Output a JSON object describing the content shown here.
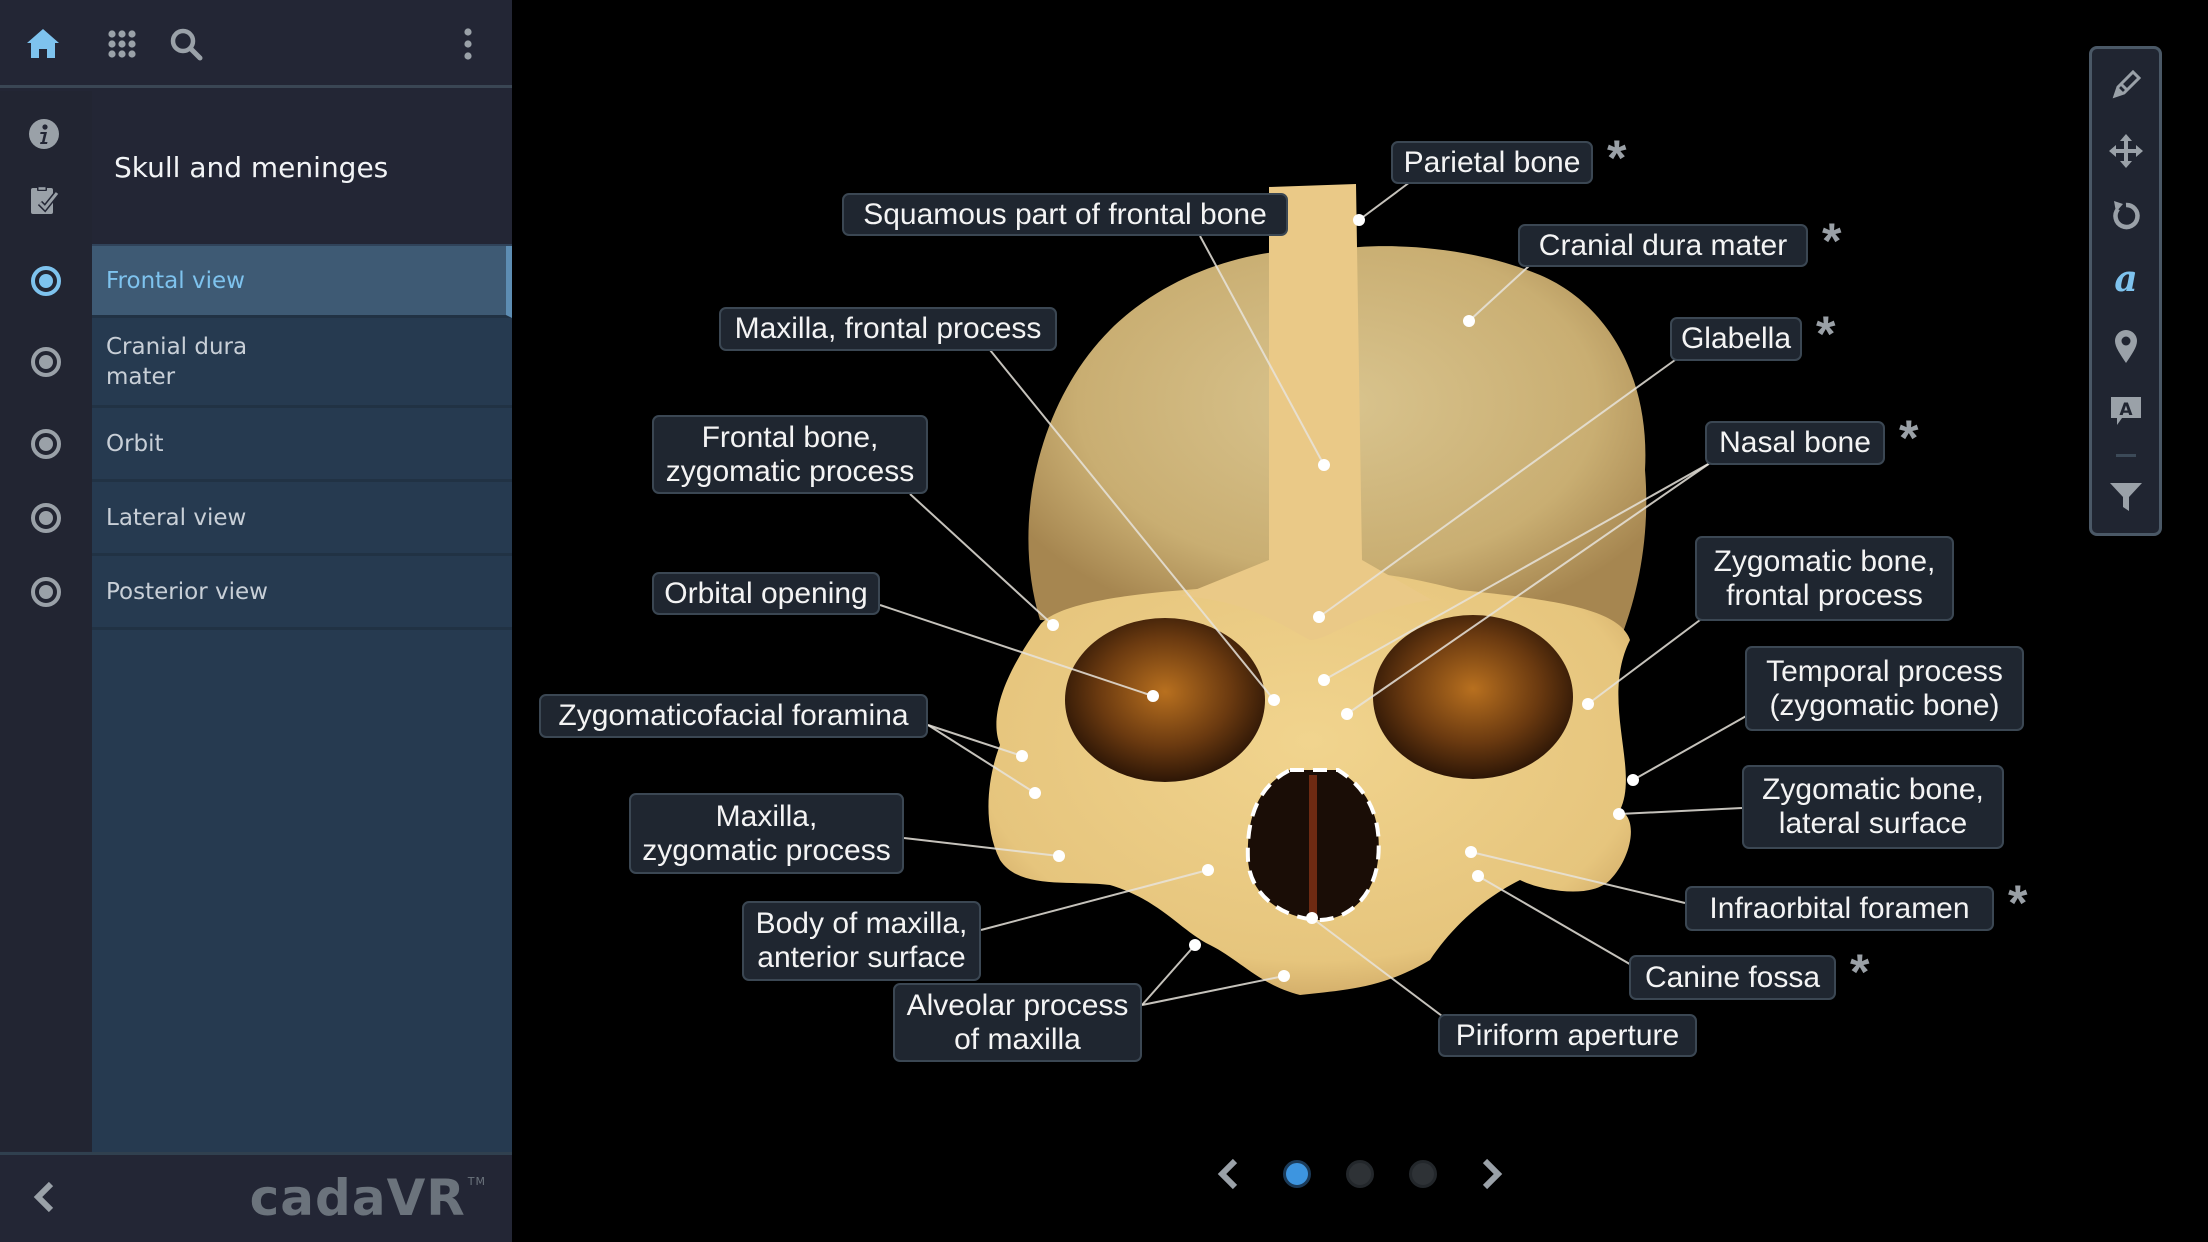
{
  "topbar": {
    "icons": [
      "home-icon",
      "apps-grid-icon",
      "search-icon",
      "more-vertical-icon"
    ]
  },
  "module": {
    "title": "Skull and meninges",
    "rail_icons": [
      "info-icon",
      "quiz-clipboard-icon"
    ]
  },
  "views": [
    {
      "label": "Frontal view",
      "active": true
    },
    {
      "label": "Cranial dura\nmater",
      "active": false
    },
    {
      "label": "Orbit",
      "active": false
    },
    {
      "label": "Lateral view",
      "active": false
    },
    {
      "label": "Posterior view",
      "active": false
    }
  ],
  "brand": {
    "name": "cadaVR",
    "trademark": "TM"
  },
  "toolbar": {
    "tools": [
      {
        "name": "draw",
        "icon": "pencil-icon",
        "active": false
      },
      {
        "name": "move",
        "icon": "move-arrows-icon",
        "active": false
      },
      {
        "name": "reset",
        "icon": "rotate-reset-icon",
        "active": false
      },
      {
        "name": "labels",
        "icon": "label-a-icon",
        "active": true
      },
      {
        "name": "pins",
        "icon": "map-pin-icon",
        "active": false
      },
      {
        "name": "annotations",
        "icon": "text-bubble-icon",
        "active": false
      },
      {
        "name": "filter",
        "icon": "filter-icon",
        "active": false
      }
    ]
  },
  "pager": {
    "pages": 3,
    "current": 1
  },
  "colors": {
    "accent": "#7ec3ee",
    "active_dot": "#3d95e0",
    "inactive_dot": "#2e3236",
    "sidebar_bg": "#232635",
    "list_bg": "#263a50",
    "active_item_bg": "#3e5a74",
    "label_bg": "#1f2630"
  },
  "labels": [
    {
      "text": "Parietal bone",
      "starred": true
    },
    {
      "text": "Squamous part of frontal bone",
      "starred": false
    },
    {
      "text": "Cranial dura mater",
      "starred": true
    },
    {
      "text": "Maxilla, frontal process",
      "starred": false
    },
    {
      "text": "Glabella",
      "starred": true
    },
    {
      "text": "Frontal bone,\nzygomatic process",
      "starred": false
    },
    {
      "text": "Nasal bone",
      "starred": true
    },
    {
      "text": "Zygomatic bone,\nfrontal process",
      "starred": false
    },
    {
      "text": "Orbital opening",
      "starred": false
    },
    {
      "text": "Temporal process\n(zygomatic bone)",
      "starred": false
    },
    {
      "text": "Zygomaticofacial foramina",
      "starred": false
    },
    {
      "text": "Zygomatic bone,\nlateral surface",
      "starred": false
    },
    {
      "text": "Maxilla,\nzygomatic process",
      "starred": false
    },
    {
      "text": "Infraorbital foramen",
      "starred": true
    },
    {
      "text": "Body of maxilla,\nanterior surface",
      "starred": false
    },
    {
      "text": "Canine fossa",
      "starred": true
    },
    {
      "text": "Alveolar process\nof maxilla",
      "starred": false
    },
    {
      "text": "Piriform aperture",
      "starred": false
    }
  ],
  "asterisk": "*"
}
